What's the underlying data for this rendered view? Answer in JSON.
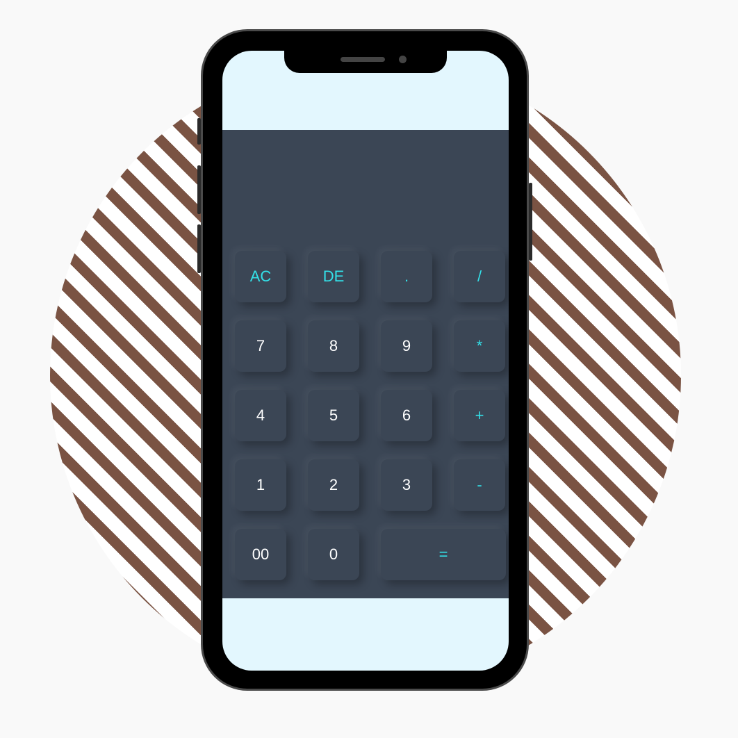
{
  "calculator": {
    "display_value": "",
    "rows": [
      [
        {
          "label": "AC",
          "type": "op"
        },
        {
          "label": "DE",
          "type": "op"
        },
        {
          "label": ".",
          "type": "op"
        },
        {
          "label": "/",
          "type": "op"
        }
      ],
      [
        {
          "label": "7",
          "type": "num"
        },
        {
          "label": "8",
          "type": "num"
        },
        {
          "label": "9",
          "type": "num"
        },
        {
          "label": "*",
          "type": "op"
        }
      ],
      [
        {
          "label": "4",
          "type": "num"
        },
        {
          "label": "5",
          "type": "num"
        },
        {
          "label": "6",
          "type": "num"
        },
        {
          "label": "+",
          "type": "op"
        }
      ],
      [
        {
          "label": "1",
          "type": "num"
        },
        {
          "label": "2",
          "type": "num"
        },
        {
          "label": "3",
          "type": "num"
        },
        {
          "label": "-",
          "type": "op"
        }
      ],
      [
        {
          "label": "00",
          "type": "num"
        },
        {
          "label": "0",
          "type": "num"
        },
        {
          "label": "=",
          "type": "op"
        }
      ]
    ]
  },
  "colors": {
    "page_background": "#f9f9f9",
    "stripe_brown": "#7a5343",
    "phone_frame": "#000000",
    "screen_background": "#e3f7fe",
    "calculator_background": "#3b4655",
    "operator_text": "#33e0e8",
    "number_text": "#ffffff"
  }
}
